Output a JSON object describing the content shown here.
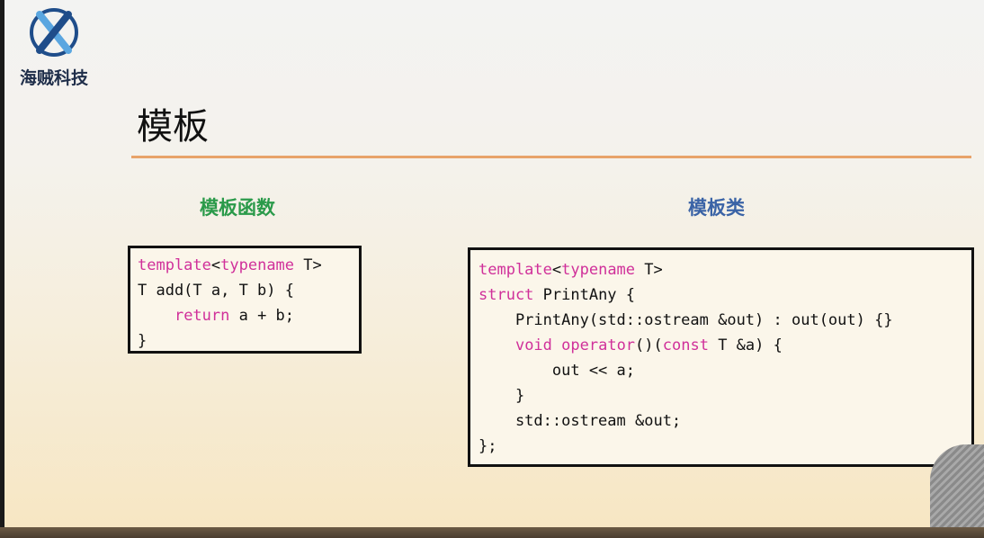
{
  "logo": {
    "text": "海贼科技",
    "icon": "x-logo-icon",
    "colors": {
      "primary": "#1f4d8a",
      "accent": "#5aa6e0"
    }
  },
  "title": "模板",
  "sections": {
    "left_heading": "模板函数",
    "right_heading": "模板类"
  },
  "colors": {
    "keyword": "#d0309a",
    "left_heading": "#2a9a4a",
    "right_heading": "#3a63a6",
    "rule": "#e8a36a"
  },
  "code_left": [
    [
      {
        "t": "template",
        "k": true
      },
      {
        "t": "<"
      },
      {
        "t": "typename",
        "k": true
      },
      {
        "t": " T>"
      }
    ],
    [
      {
        "t": "T add(T a, T b) {"
      }
    ],
    [
      {
        "t": "    "
      },
      {
        "t": "return",
        "k": true
      },
      {
        "t": " a + b;"
      }
    ],
    [
      {
        "t": "}"
      }
    ]
  ],
  "code_right": [
    [
      {
        "t": "template",
        "k": true
      },
      {
        "t": "<"
      },
      {
        "t": "typename",
        "k": true
      },
      {
        "t": " T>"
      }
    ],
    [
      {
        "t": "struct",
        "k": true
      },
      {
        "t": " PrintAny {"
      }
    ],
    [
      {
        "t": "    PrintAny(std::ostream &out) : out(out) {}"
      }
    ],
    [
      {
        "t": "    "
      },
      {
        "t": "void",
        "k": true
      },
      {
        "t": " "
      },
      {
        "t": "operator",
        "k": true
      },
      {
        "t": "()("
      },
      {
        "t": "const",
        "k": true
      },
      {
        "t": " T &a) {"
      }
    ],
    [
      {
        "t": "        out << a;"
      }
    ],
    [
      {
        "t": "    }"
      }
    ],
    [
      {
        "t": "    std::ostream &out;"
      }
    ],
    [
      {
        "t": "};"
      }
    ]
  ]
}
